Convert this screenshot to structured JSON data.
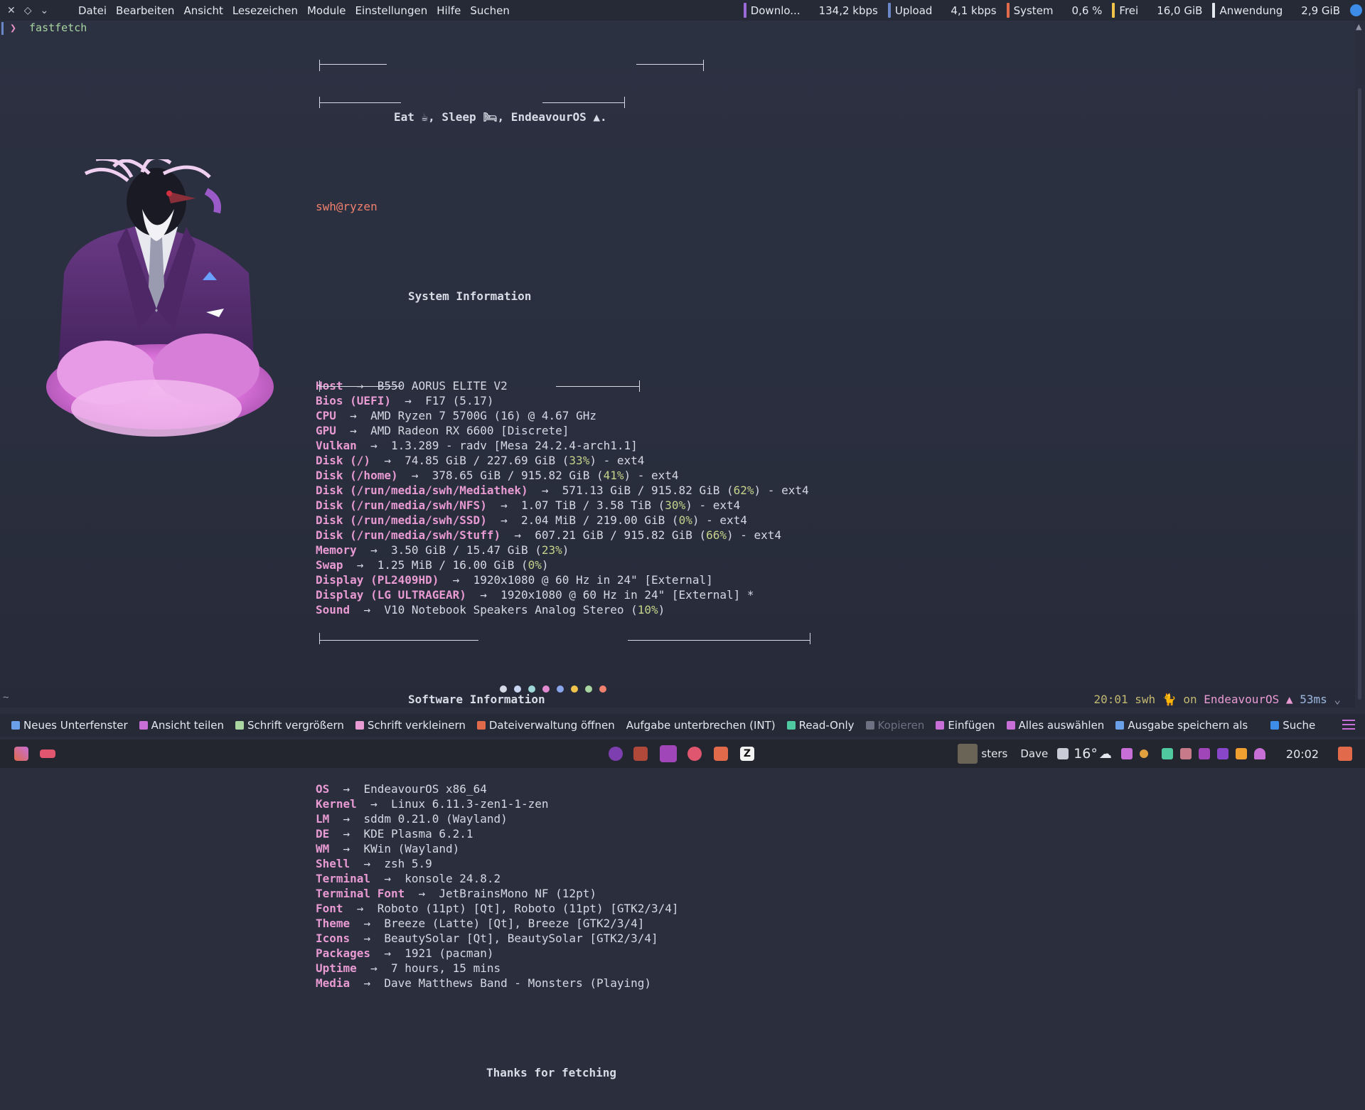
{
  "window": {
    "controls": {
      "close": "✕",
      "pin": "◇",
      "more": "⌄"
    },
    "menu": [
      "Datei",
      "Bearbeiten",
      "Ansicht",
      "Lesezeichen",
      "Module",
      "Einstellungen",
      "Hilfe",
      "Suchen"
    ],
    "monitors": [
      {
        "label": "Downlo...",
        "value": "134,2 kbps",
        "color": "#9a6bd8"
      },
      {
        "label": "Upload",
        "value": "4,1 kbps",
        "color": "#6b86c7"
      },
      {
        "label": "System",
        "value": "0,6 %",
        "color": "#e06a4a"
      },
      {
        "label": "Frei",
        "value": "16,0 GiB",
        "color": "#f0c34a"
      },
      {
        "label": "Anwendung",
        "value": "2,9 GiB",
        "color": "#e6e8ef"
      }
    ]
  },
  "terminal": {
    "prompt_symbol": "❯",
    "command": "fastfetch",
    "banner": {
      "eat": "Eat ☕, Sleep 🛏, EndeavourOS ▲."
    },
    "user_host": "swh@ryzen",
    "system_header": "System Information",
    "system": [
      {
        "k": "Host",
        "v": "B550 AORUS ELITE V2"
      },
      {
        "k": "Bios (UEFI)",
        "v": "F17 (5.17)"
      },
      {
        "k": "CPU",
        "v": "AMD Ryzen 7 5700G (16) @ 4.67 GHz"
      },
      {
        "k": "GPU",
        "v": "AMD Radeon RX 6600 [Discrete]"
      },
      {
        "k": "Vulkan",
        "v": "1.3.289 - radv [Mesa 24.2.4-arch1.1]"
      },
      {
        "k": "Disk (/)",
        "v": "74.85 GiB / 227.69 GiB (",
        "p": "33%",
        "t": ") - ext4"
      },
      {
        "k": "Disk (/home)",
        "v": "378.65 GiB / 915.82 GiB (",
        "p": "41%",
        "t": ") - ext4"
      },
      {
        "k": "Disk (/run/media/swh/Mediathek)",
        "v": "571.13 GiB / 915.82 GiB (",
        "p": "62%",
        "t": ") - ext4"
      },
      {
        "k": "Disk (/run/media/swh/NFS)",
        "v": "1.07 TiB / 3.58 TiB (",
        "p": "30%",
        "t": ") - ext4"
      },
      {
        "k": "Disk (/run/media/swh/SSD)",
        "v": "2.04 MiB / 219.00 GiB (",
        "p": "0%",
        "t": ") - ext4"
      },
      {
        "k": "Disk (/run/media/swh/Stuff)",
        "v": "607.21 GiB / 915.82 GiB (",
        "p": "66%",
        "t": ") - ext4"
      },
      {
        "k": "Memory",
        "v": "3.50 GiB / 15.47 GiB (",
        "p": "23%",
        "t": ")"
      },
      {
        "k": "Swap",
        "v": "1.25 MiB / 16.00 GiB (",
        "p": "0%",
        "t": ")"
      },
      {
        "k": "Display (PL2409HD)",
        "v": "1920x1080 @ 60 Hz in 24\" [External]"
      },
      {
        "k": "Display (LG ULTRAGEAR)",
        "v": "1920x1080 @ 60 Hz in 24\" [External] *"
      },
      {
        "k": "Sound",
        "v": "V10 Notebook Speakers Analog Stereo (",
        "p": "10%",
        "t": ")"
      }
    ],
    "software_header": "Software Information",
    "software": [
      {
        "k": "OS",
        "v": "EndeavourOS x86_64"
      },
      {
        "k": "Kernel",
        "v": "Linux 6.11.3-zen1-1-zen"
      },
      {
        "k": "LM",
        "v": "sddm 0.21.0 (Wayland)"
      },
      {
        "k": "DE",
        "v": "KDE Plasma 6.2.1"
      },
      {
        "k": "WM",
        "v": "KWin (Wayland)"
      },
      {
        "k": "Shell",
        "v": "zsh 5.9"
      },
      {
        "k": "Terminal",
        "v": "konsole 24.8.2"
      },
      {
        "k": "Terminal Font",
        "v": "JetBrainsMono NF (12pt)"
      },
      {
        "k": "Font",
        "v": "Roboto (11pt) [Qt], Roboto (11pt) [GTK2/3/4]"
      },
      {
        "k": "Theme",
        "v": "Breeze (Latte) [Qt], Breeze [GTK2/3/4]"
      },
      {
        "k": "Icons",
        "v": "BeautySolar [Qt], BeautySolar [GTK2/3/4]"
      },
      {
        "k": "Packages",
        "v": "1921 (pacman)"
      },
      {
        "k": "Uptime",
        "v": "7 hours, 15 mins"
      },
      {
        "k": "Media",
        "v": "Dave Matthews Band - Monsters (Playing)"
      }
    ],
    "footer": "Thanks for fetching",
    "arrow": "→",
    "palette": [
      "#d6d9e6",
      "#c9d4f0",
      "#9fd8d8",
      "#e18ad0",
      "#8aa6ea",
      "#f0c34a",
      "#a9d6a0",
      "#f0806e"
    ],
    "tilde": "~",
    "rprompt": {
      "time": "20:01",
      "user": "swh",
      "on": "on",
      "os": "EndeavourOS",
      "duration": "53ms"
    }
  },
  "toolbar": [
    {
      "label": "Neues Unterfenster",
      "color": "#6aa0e8",
      "name": "new-tab-button"
    },
    {
      "label": "Ansicht teilen",
      "color": "#c76fd6",
      "name": "split-view-button"
    },
    {
      "label": "Schrift vergrößern",
      "color": "#a9d6a0",
      "name": "font-bigger-button"
    },
    {
      "label": "Schrift verkleinern",
      "color": "#e89ad2",
      "name": "font-smaller-button"
    },
    {
      "label": "Dateiverwaltung öffnen",
      "color": "#e06a4a",
      "name": "open-file-manager-button"
    },
    {
      "label": "Aufgabe unterbrechen (INT)",
      "color": "",
      "name": "interrupt-task-button"
    },
    {
      "label": "Read-Only",
      "color": "#4ec9a0",
      "name": "read-only-button"
    },
    {
      "label": "Kopieren",
      "color": "#6d7283",
      "name": "copy-button",
      "disabled": true
    },
    {
      "label": "Einfügen",
      "color": "#c76fd6",
      "name": "paste-button"
    },
    {
      "label": "Alles auswählen",
      "color": "#c76fd6",
      "name": "select-all-button"
    },
    {
      "label": "Ausgabe speichern als",
      "color": "#6aa0e8",
      "name": "save-output-button"
    },
    {
      "label": "Suche",
      "color": "#3c8ce8",
      "name": "search-button"
    }
  ],
  "tray": {
    "media": "sters",
    "artist": "Dave",
    "temp": "16°",
    "clock": "20:02"
  }
}
